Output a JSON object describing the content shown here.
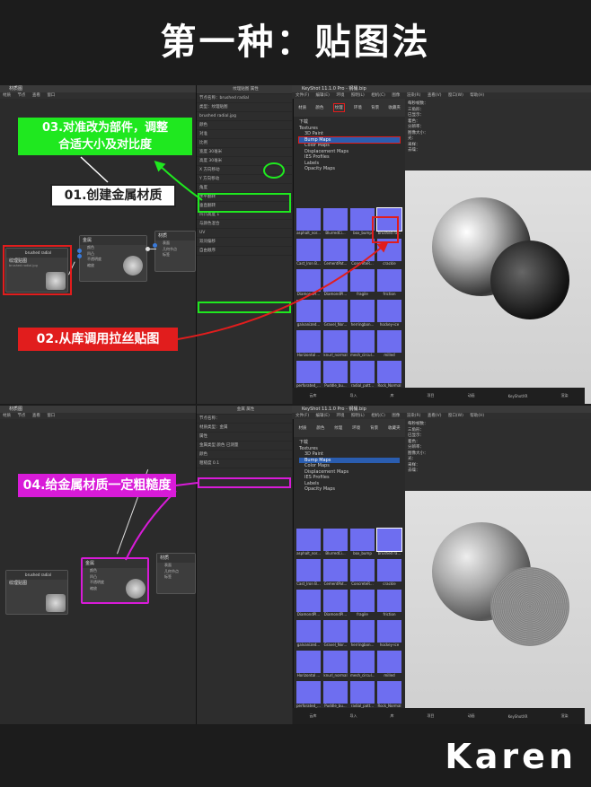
{
  "title": "第一种：贴图法",
  "brand": "Karen",
  "shot1": {
    "window_left": "材质图",
    "window_right": "KeyShot 11.1.0 Pro - 钢桶.bip",
    "menu_left": [
      "材质",
      "节点",
      "查看",
      "窗口"
    ],
    "menu_right": [
      "文件(F)",
      "编辑(E)",
      "环境",
      "照明(L)",
      "相机(C)",
      "图像",
      "渲染(R)",
      "查看(V)",
      "窗口(W)",
      "帮助(H)"
    ],
    "node_texture": {
      "name": "brushed radial",
      "title": "纹理贴图",
      "sub": "brushed radial.jpg"
    },
    "node_metal": {
      "title": "金属",
      "ports": [
        "颜色",
        "凹凸",
        "不透明度",
        "缩放"
      ]
    },
    "node_material": {
      "title": "材质",
      "ports": [
        "表面",
        "几何节点",
        "标签"
      ]
    },
    "prop_rows": [
      "节点名称：brushed radial",
      "类型：纹理贴图",
      "brushed radial.jpg",
      "颜色",
      "对准",
      "比例",
      "宽度  30毫米",
      "高度  30毫米",
      "X 方向移动",
      "Y 方向移动",
      "角度",
      "水平翻转",
      "垂直翻转",
      "凹凸高度  1",
      "与颜色混合",
      "UV",
      "双问偏移",
      "自由顺序"
    ],
    "library_tabs": [
      "材质",
      "颜色",
      "纹理",
      "环境",
      "背景",
      "收藏夹"
    ],
    "tree": [
      "下载",
      "Textures",
      "3D Paint",
      "Bump Maps",
      "Color Maps",
      "Displacement Maps",
      "IES Profiles",
      "Labels",
      "Opacity Maps"
    ],
    "tree_selected": 3,
    "tiles": [
      "asphalt_nor...",
      "BlurredCi...",
      "box_bump",
      "brushed ra...",
      "Cast_Iron B...",
      "CementPat...",
      "ConcreteR...",
      "crackle",
      "DiamondPl...",
      "DiamondPl...",
      "fragile",
      "friction",
      "galvanized...",
      "Gravel_Nor...",
      "herringbon...",
      "hockey-ice",
      "Horizontal ...",
      "knurl_normal",
      "mesh_circul...",
      "milled",
      "perforated_...",
      "Puddle_bu...",
      "radial_patt...",
      "Rock_Normal"
    ],
    "stats": [
      "每秒帧数：",
      "三角形：",
      "已显示：",
      "着色：",
      "分辨率：",
      "图像大小：",
      "光：",
      "采样：",
      "去噪："
    ],
    "bottom_tabs": [
      "云库",
      "导入",
      "库",
      "项目",
      "动画",
      "KeyShotXR",
      "渲染"
    ],
    "callouts": {
      "step1": "01.创建金属材质",
      "step2": "02.从库调用拉丝贴图",
      "step3": "03.对准改为部件，调整\n合适大小及对比度"
    }
  },
  "shot2": {
    "window_right": "KeyShot 11.1.0 Pro - 钢桶.bip",
    "node_texture": {
      "name": "brushed radial",
      "title": "纹理贴图"
    },
    "node_metal": {
      "title": "金属",
      "ports": [
        "颜色",
        "凹凸",
        "不透明度",
        "缩放"
      ]
    },
    "node_material": {
      "title": "材质",
      "ports": [
        "表面",
        "几何节点",
        "标签"
      ]
    },
    "prop_rows": [
      "节点名称：",
      "材质类型：金属",
      "金属",
      "属性",
      "纹理",
      "金属类型 颜色 已测量",
      "颜色",
      "粗糙度  0.1"
    ],
    "callout": "04.给金属材质一定粗糙度"
  },
  "colors": {
    "green": "#1fe81f",
    "red": "#e11d1d",
    "magenta": "#d81bd8",
    "blue": "#6e6ef0"
  }
}
